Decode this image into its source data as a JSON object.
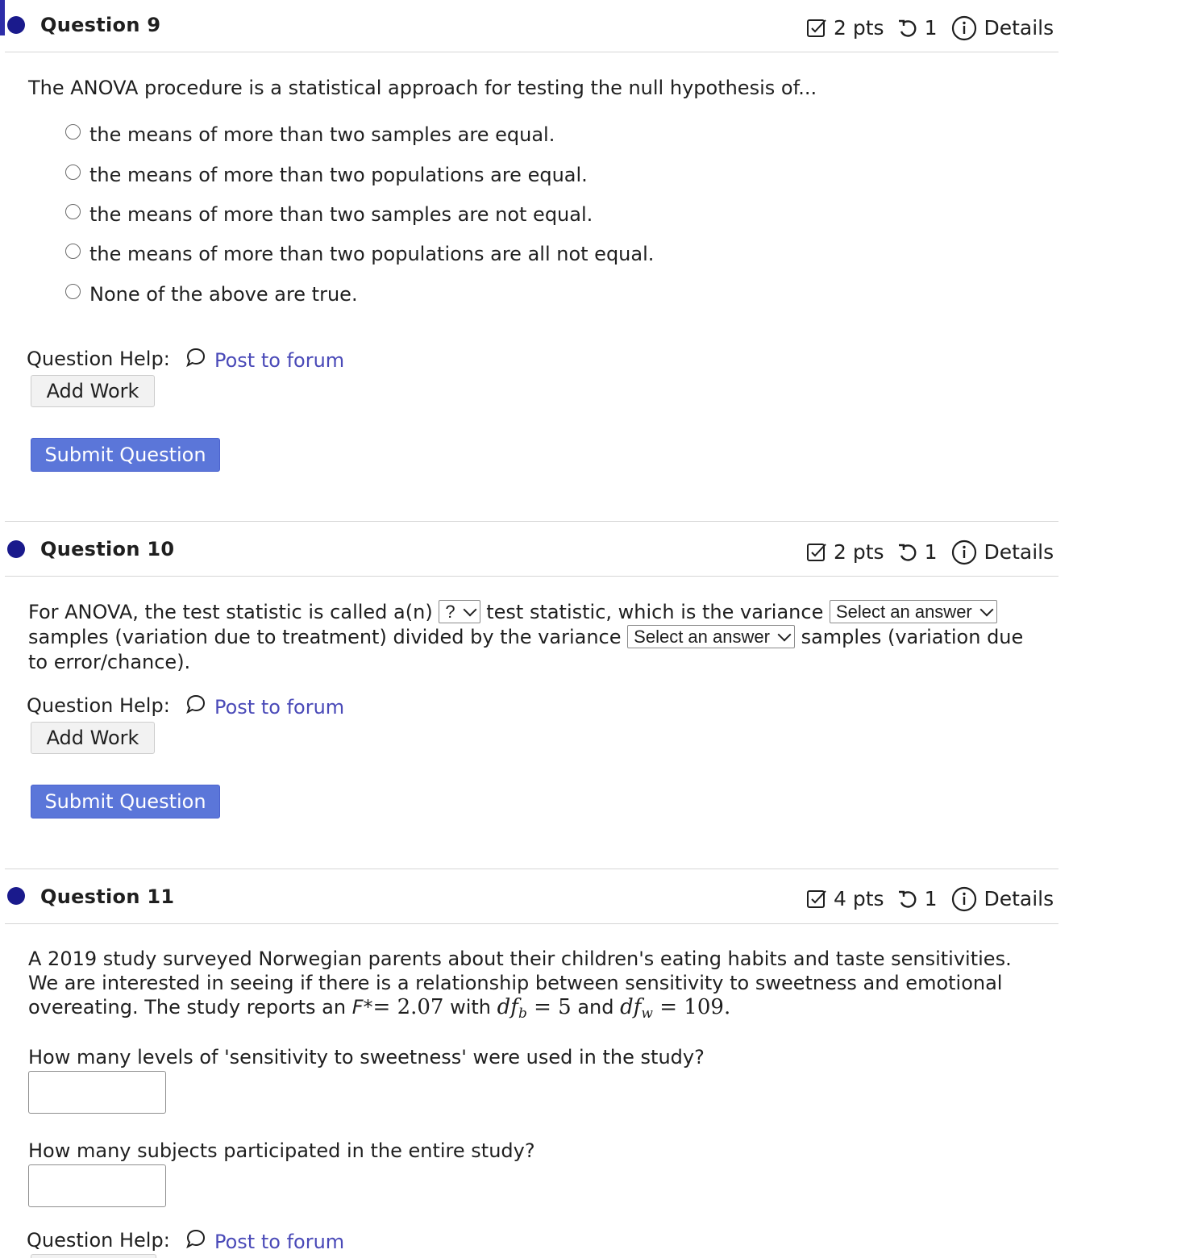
{
  "colors": {
    "accent": "#1a1a8c",
    "link": "#4a4ab8",
    "submit": "#5b76d9"
  },
  "icons": {
    "points": "checkbox-icon",
    "attempts": "retry-icon",
    "details": "info-icon",
    "forum": "speech-bubble-icon"
  },
  "q9": {
    "title": "Question 9",
    "points": "2 pts",
    "attempts": "1",
    "details": "Details",
    "prompt": "The ANOVA procedure is a statistical approach for testing the null hypothesis of...",
    "options": [
      "the means of more than two samples are equal.",
      "the means of more than two populations are equal.",
      "the means of more than two samples are not equal.",
      "the means of more than two populations are all not equal.",
      "None of the above are true."
    ],
    "help_label": "Question Help:",
    "forum": "Post to forum",
    "add_work": "Add Work",
    "submit": "Submit Question"
  },
  "q10": {
    "title": "Question 10",
    "points": "2 pts",
    "attempts": "1",
    "details": "Details",
    "part1": "For ANOVA, the test statistic is called a(n)",
    "select1": "?",
    "part2": "test statistic, which is the variance",
    "select2": "Select an answer",
    "part3": "samples (variation due to treatment) divided by the variance",
    "select3": "Select an answer",
    "part4": "samples (variation due to error/chance).",
    "help_label": "Question Help:",
    "forum": "Post to forum",
    "add_work": "Add Work",
    "submit": "Submit Question"
  },
  "q11": {
    "title": "Question 11",
    "points": "4 pts",
    "attempts": "1",
    "details": "Details",
    "intro1": "A 2019 study surveyed Norwegian parents about their children's eating habits and taste sensitivities. We are interested in seeing if there is a relationship between sensitivity to sweetness and emotional overeating.",
    "intro2_a": "The study reports an ",
    "f_label": "F*",
    "f_eq": "= 2.07",
    "with": " with ",
    "df_b": "5",
    "and": " and ",
    "df_w": "109",
    "period": ".",
    "q1": "How many levels of 'sensitivity to sweetness' were used in the study?",
    "q1_value": "",
    "q2": "How many subjects participated in the entire study?",
    "q2_value": "",
    "help_label": "Question Help:",
    "forum": "Post to forum"
  }
}
